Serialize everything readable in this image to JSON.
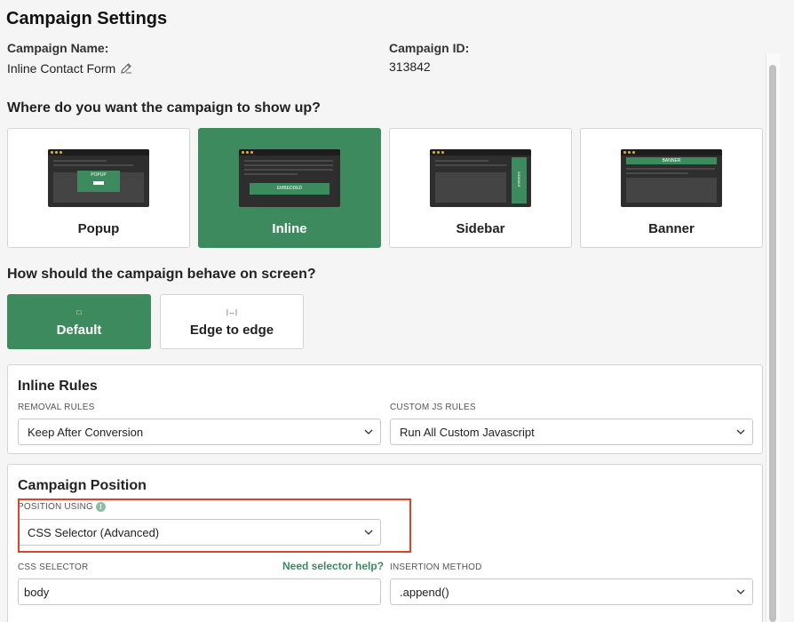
{
  "page": {
    "title": "Campaign Settings"
  },
  "campaign": {
    "name_label": "Campaign Name:",
    "name": "Inline Contact Form",
    "id_label": "Campaign ID:",
    "id": "313842"
  },
  "placement": {
    "question": "Where do you want the campaign to show up?",
    "selected": "Inline",
    "options": [
      {
        "label": "Popup",
        "thumb_text": "POPUP"
      },
      {
        "label": "Inline",
        "thumb_text": "EMBEDDED"
      },
      {
        "label": "Sidebar",
        "thumb_text": "SIDEBAR"
      },
      {
        "label": "Banner",
        "thumb_text": "BANNER"
      }
    ]
  },
  "behavior": {
    "question": "How should the campaign behave on screen?",
    "selected": "Default",
    "options": [
      {
        "label": "Default",
        "icon": "□"
      },
      {
        "label": "Edge to edge",
        "icon": "|↔|"
      }
    ]
  },
  "inline_rules": {
    "title": "Inline Rules",
    "removal_label": "REMOVAL RULES",
    "removal_value": "Keep After Conversion",
    "custom_js_label": "CUSTOM JS RULES",
    "custom_js_value": "Run All Custom Javascript"
  },
  "position": {
    "title": "Campaign Position",
    "using_label": "POSITION USING",
    "using_value": "CSS Selector (Advanced)",
    "selector_label": "CSS SELECTOR",
    "selector_help": "Need selector help?",
    "selector_value": "body",
    "insertion_label": "INSERTION METHOD",
    "insertion_value": ".append()"
  },
  "colors": {
    "accent": "#3d8a5f",
    "highlight": "#d9472b"
  }
}
